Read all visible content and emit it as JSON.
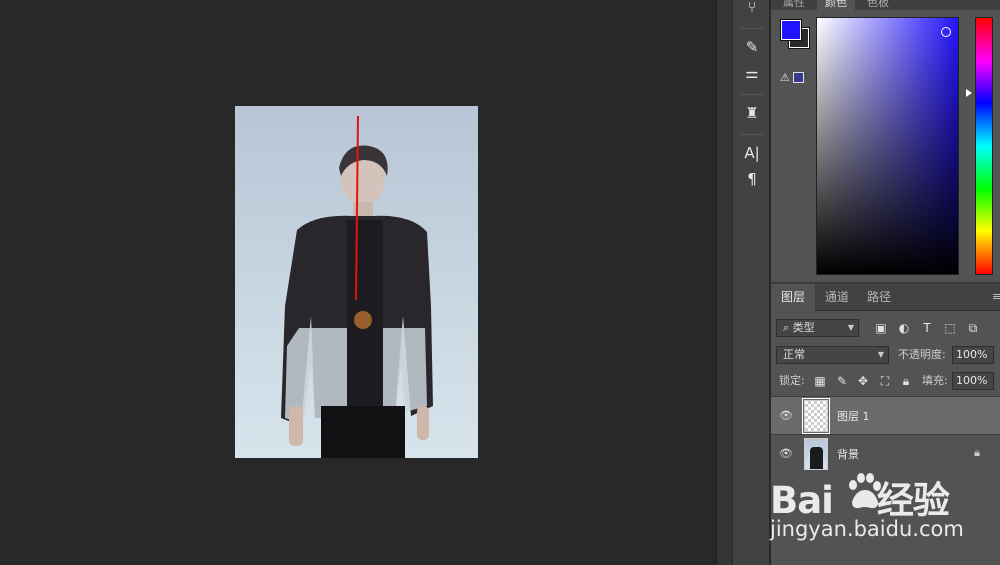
{
  "color_panel": {
    "tabs": [
      "属性",
      "颜色",
      "色板"
    ],
    "foreground_color": "#2314ff",
    "background_color": "#2a2a2a",
    "gamut_warning_color": "#333c8e"
  },
  "layers_panel": {
    "tabs": [
      "图层",
      "通道",
      "路径"
    ],
    "filter_kind": "类型",
    "blend_mode": "正常",
    "opacity_label": "不透明度:",
    "opacity_value": "100%",
    "lock_label": "锁定:",
    "fill_label": "填充:",
    "fill_value": "100%",
    "layers": [
      {
        "name": "图层 1",
        "visible": true,
        "selected": true,
        "locked": false
      },
      {
        "name": "背景",
        "visible": true,
        "selected": false,
        "locked": true
      }
    ]
  },
  "tools": {
    "groups": [
      [
        "history-brush-icon"
      ],
      [
        "brush-settings-icon",
        "adjustments-icon"
      ],
      [
        "clone-stamp-icon"
      ],
      [
        "character-icon",
        "paragraph-icon"
      ]
    ]
  },
  "canvas": {
    "stroke_color": "#e3140f"
  },
  "watermark": {
    "logo": "Bai",
    "logo_suffix": "经验",
    "url": "jingyan.baidu.com"
  }
}
